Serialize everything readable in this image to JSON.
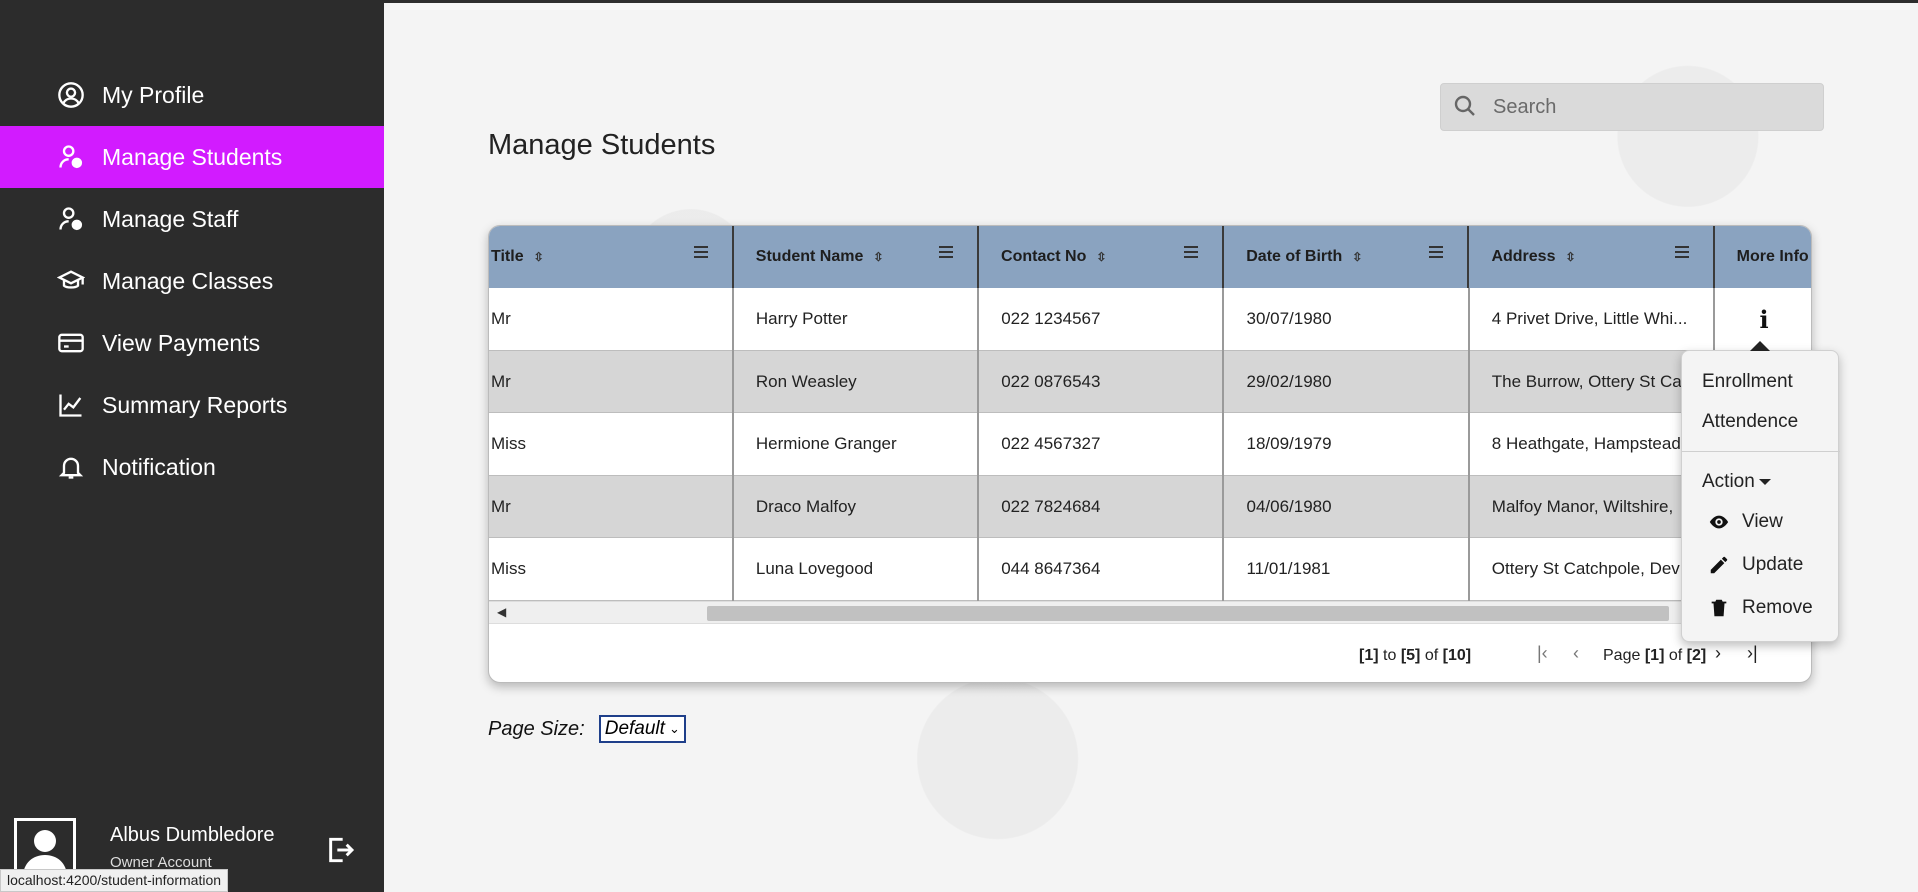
{
  "sidebar": {
    "items": [
      {
        "label": "My Profile",
        "icon": "user-circle-icon",
        "active": false
      },
      {
        "label": "Manage Students",
        "icon": "user-gear-icon",
        "active": true
      },
      {
        "label": "Manage Staff",
        "icon": "user-gear-icon",
        "active": false
      },
      {
        "label": "Manage Classes",
        "icon": "graduation-cap-icon",
        "active": false
      },
      {
        "label": "View Payments",
        "icon": "credit-card-icon",
        "active": false
      },
      {
        "label": "Summary Reports",
        "icon": "line-chart-icon",
        "active": false
      },
      {
        "label": "Notification",
        "icon": "bell-icon",
        "active": false
      }
    ],
    "user": {
      "name": "Albus Dumbledore",
      "role": "Owner Account"
    },
    "accent": "#d21bff",
    "background": "#2c2c2c"
  },
  "status_url": "localhost:4200/student-information",
  "search": {
    "placeholder": "Search",
    "value": ""
  },
  "page_title": "Manage Students",
  "table": {
    "header_color": "#8aa3c0",
    "columns": [
      "Title",
      "Student Name",
      "Contact No",
      "Date of Birth",
      "Address",
      "More Info"
    ],
    "rows": [
      [
        "Mr",
        "Harry Potter",
        "022 1234567",
        "30/07/1980",
        "4 Privet Drive, Little Whi...",
        "i"
      ],
      [
        "Mr",
        "Ron Weasley",
        "022 0876543",
        "29/02/1980",
        "The Burrow, Ottery St Ca",
        ""
      ],
      [
        "Miss",
        "Hermione Granger",
        "022 4567327",
        "18/09/1979",
        "8 Heathgate, Hampstead",
        ""
      ],
      [
        "Mr",
        "Draco Malfoy",
        "022 7824684",
        "04/06/1980",
        "Malfoy Manor, Wiltshire,",
        ""
      ],
      [
        "Miss",
        "Luna Lovegood",
        "044 8647364",
        "11/01/1981",
        "Ottery St Catchpole, Dev",
        ""
      ]
    ]
  },
  "pager": {
    "from": "1",
    "to": "5",
    "total": "10",
    "page": "1",
    "pages": "2",
    "to_word": "to",
    "of_word": "of",
    "page_word": "Page"
  },
  "page_size": {
    "label": "Page Size:",
    "selected": "Default"
  },
  "popup": {
    "items": [
      "Enrollment",
      "Attendence"
    ],
    "action_label": "Action",
    "actions": [
      {
        "label": "View",
        "icon": "eye-icon"
      },
      {
        "label": "Update",
        "icon": "pencil-icon"
      },
      {
        "label": "Remove",
        "icon": "trash-icon"
      }
    ]
  }
}
